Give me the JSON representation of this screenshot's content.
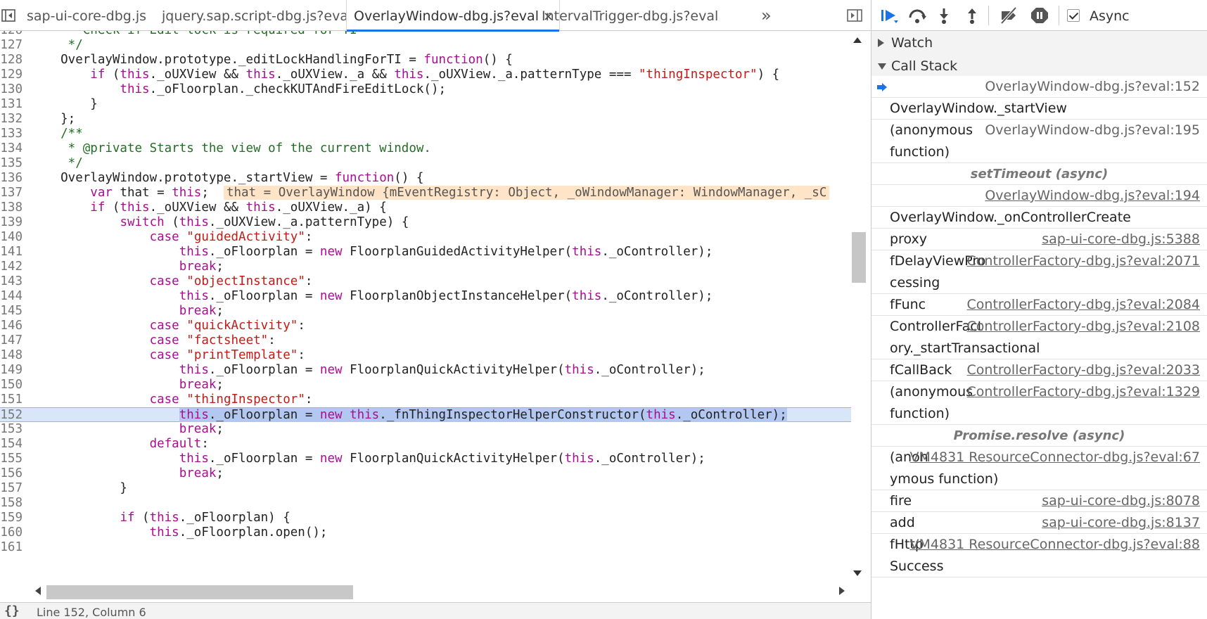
{
  "tabs": [
    {
      "label": "sap-ui-core-dbg.js",
      "active": false
    },
    {
      "label": "jquery.sap.script-dbg.js?eval",
      "active": false
    },
    {
      "label": "OverlayWindow-dbg.js?eval",
      "active": true,
      "close": "×"
    },
    {
      "label": "IntervalTrigger-dbg.js?eval",
      "active": false
    }
  ],
  "overflow_label": "»",
  "code": {
    "lines": [
      {
        "no": "126",
        "parts": [
          {
            "t": "     * Check if Edit lock is required for TI",
            "c": "c"
          }
        ]
      },
      {
        "no": "127",
        "parts": [
          {
            "t": "     */",
            "c": "c"
          }
        ]
      },
      {
        "no": "128",
        "parts": [
          {
            "t": "    OverlayWindow.prototype._editLockHandlingForTI = ",
            "c": "p"
          },
          {
            "t": "function",
            "c": "k"
          },
          {
            "t": "() {",
            "c": "p"
          }
        ]
      },
      {
        "no": "129",
        "parts": [
          {
            "t": "        ",
            "c": "p"
          },
          {
            "t": "if",
            "c": "k"
          },
          {
            "t": " (",
            "c": "p"
          },
          {
            "t": "this",
            "c": "k"
          },
          {
            "t": "._oUXView && ",
            "c": "p"
          },
          {
            "t": "this",
            "c": "k"
          },
          {
            "t": "._oUXView._a && ",
            "c": "p"
          },
          {
            "t": "this",
            "c": "k"
          },
          {
            "t": "._oUXView._a.patternType === ",
            "c": "p"
          },
          {
            "t": "\"thingInspector\"",
            "c": "s"
          },
          {
            "t": ") {",
            "c": "p"
          }
        ]
      },
      {
        "no": "130",
        "parts": [
          {
            "t": "            ",
            "c": "p"
          },
          {
            "t": "this",
            "c": "k"
          },
          {
            "t": "._oFloorplan._checkKUTAndFireEditLock();",
            "c": "p"
          }
        ]
      },
      {
        "no": "131",
        "parts": [
          {
            "t": "        }",
            "c": "p"
          }
        ]
      },
      {
        "no": "132",
        "parts": [
          {
            "t": "    };",
            "c": "p"
          }
        ]
      },
      {
        "no": "133",
        "parts": [
          {
            "t": "    /**",
            "c": "c"
          }
        ]
      },
      {
        "no": "134",
        "parts": [
          {
            "t": "     * @private Starts the view of the current window.",
            "c": "c"
          }
        ]
      },
      {
        "no": "135",
        "parts": [
          {
            "t": "     */",
            "c": "c"
          }
        ]
      },
      {
        "no": "136",
        "parts": [
          {
            "t": "    OverlayWindow.prototype._startView = ",
            "c": "p"
          },
          {
            "t": "function",
            "c": "k"
          },
          {
            "t": "() {",
            "c": "p"
          }
        ]
      },
      {
        "no": "137",
        "parts": [
          {
            "t": "        ",
            "c": "p"
          },
          {
            "t": "var",
            "c": "k"
          },
          {
            "t": " that = ",
            "c": "p"
          },
          {
            "t": "this",
            "c": "k"
          },
          {
            "t": ";  ",
            "c": "p"
          },
          {
            "t": "that = OverlayWindow {mEventRegistry: Object, _oWindowManager: WindowManager, _sC",
            "c": "inline"
          }
        ]
      },
      {
        "no": "138",
        "parts": [
          {
            "t": "        ",
            "c": "p"
          },
          {
            "t": "if",
            "c": "k"
          },
          {
            "t": " (",
            "c": "p"
          },
          {
            "t": "this",
            "c": "k"
          },
          {
            "t": "._oUXView && ",
            "c": "p"
          },
          {
            "t": "this",
            "c": "k"
          },
          {
            "t": "._oUXView._a) {",
            "c": "p"
          }
        ]
      },
      {
        "no": "139",
        "parts": [
          {
            "t": "            ",
            "c": "p"
          },
          {
            "t": "switch",
            "c": "k"
          },
          {
            "t": " (",
            "c": "p"
          },
          {
            "t": "this",
            "c": "k"
          },
          {
            "t": "._oUXView._a.patternType) {",
            "c": "p"
          }
        ]
      },
      {
        "no": "140",
        "parts": [
          {
            "t": "                ",
            "c": "p"
          },
          {
            "t": "case",
            "c": "k"
          },
          {
            "t": " ",
            "c": "p"
          },
          {
            "t": "\"guidedActivity\"",
            "c": "s"
          },
          {
            "t": ":",
            "c": "p"
          }
        ]
      },
      {
        "no": "141",
        "parts": [
          {
            "t": "                    ",
            "c": "p"
          },
          {
            "t": "this",
            "c": "k"
          },
          {
            "t": "._oFloorplan = ",
            "c": "p"
          },
          {
            "t": "new",
            "c": "k"
          },
          {
            "t": " FloorplanGuidedActivityHelper(",
            "c": "p"
          },
          {
            "t": "this",
            "c": "k"
          },
          {
            "t": "._oController);",
            "c": "p"
          }
        ]
      },
      {
        "no": "142",
        "parts": [
          {
            "t": "                    ",
            "c": "p"
          },
          {
            "t": "break",
            "c": "k"
          },
          {
            "t": ";",
            "c": "p"
          }
        ]
      },
      {
        "no": "143",
        "parts": [
          {
            "t": "                ",
            "c": "p"
          },
          {
            "t": "case",
            "c": "k"
          },
          {
            "t": " ",
            "c": "p"
          },
          {
            "t": "\"objectInstance\"",
            "c": "s"
          },
          {
            "t": ":",
            "c": "p"
          }
        ]
      },
      {
        "no": "144",
        "parts": [
          {
            "t": "                    ",
            "c": "p"
          },
          {
            "t": "this",
            "c": "k"
          },
          {
            "t": "._oFloorplan = ",
            "c": "p"
          },
          {
            "t": "new",
            "c": "k"
          },
          {
            "t": " FloorplanObjectInstanceHelper(",
            "c": "p"
          },
          {
            "t": "this",
            "c": "k"
          },
          {
            "t": "._oController);",
            "c": "p"
          }
        ]
      },
      {
        "no": "145",
        "parts": [
          {
            "t": "                    ",
            "c": "p"
          },
          {
            "t": "break",
            "c": "k"
          },
          {
            "t": ";",
            "c": "p"
          }
        ]
      },
      {
        "no": "146",
        "parts": [
          {
            "t": "                ",
            "c": "p"
          },
          {
            "t": "case",
            "c": "k"
          },
          {
            "t": " ",
            "c": "p"
          },
          {
            "t": "\"quickActivity\"",
            "c": "s"
          },
          {
            "t": ":",
            "c": "p"
          }
        ]
      },
      {
        "no": "147",
        "parts": [
          {
            "t": "                ",
            "c": "p"
          },
          {
            "t": "case",
            "c": "k"
          },
          {
            "t": " ",
            "c": "p"
          },
          {
            "t": "\"factsheet\"",
            "c": "s"
          },
          {
            "t": ":",
            "c": "p"
          }
        ]
      },
      {
        "no": "148",
        "parts": [
          {
            "t": "                ",
            "c": "p"
          },
          {
            "t": "case",
            "c": "k"
          },
          {
            "t": " ",
            "c": "p"
          },
          {
            "t": "\"printTemplate\"",
            "c": "s"
          },
          {
            "t": ":",
            "c": "p"
          }
        ]
      },
      {
        "no": "149",
        "parts": [
          {
            "t": "                    ",
            "c": "p"
          },
          {
            "t": "this",
            "c": "k"
          },
          {
            "t": "._oFloorplan = ",
            "c": "p"
          },
          {
            "t": "new",
            "c": "k"
          },
          {
            "t": " FloorplanQuickActivityHelper(",
            "c": "p"
          },
          {
            "t": "this",
            "c": "k"
          },
          {
            "t": "._oController);",
            "c": "p"
          }
        ]
      },
      {
        "no": "150",
        "parts": [
          {
            "t": "                    ",
            "c": "p"
          },
          {
            "t": "break",
            "c": "k"
          },
          {
            "t": ";",
            "c": "p"
          }
        ]
      },
      {
        "no": "151",
        "parts": [
          {
            "t": "                ",
            "c": "p"
          },
          {
            "t": "case",
            "c": "k"
          },
          {
            "t": " ",
            "c": "p"
          },
          {
            "t": "\"thingInspector\"",
            "c": "s"
          },
          {
            "t": ":",
            "c": "p"
          }
        ]
      },
      {
        "no": "152",
        "current": true,
        "parts": [
          {
            "t": "                    ",
            "c": "p"
          },
          {
            "t": "this",
            "c": "k sel"
          },
          {
            "t": "._oFloorplan = ",
            "c": "p sel"
          },
          {
            "t": "new",
            "c": "k sel"
          },
          {
            "t": " ",
            "c": "p sel"
          },
          {
            "t": "this",
            "c": "k sel"
          },
          {
            "t": "._fnThingInspectorHelperConstructor(",
            "c": "p sel"
          },
          {
            "t": "this",
            "c": "k sel"
          },
          {
            "t": "._oController);",
            "c": "p sel"
          }
        ]
      },
      {
        "no": "153",
        "parts": [
          {
            "t": "                    ",
            "c": "p"
          },
          {
            "t": "break",
            "c": "k"
          },
          {
            "t": ";",
            "c": "p"
          }
        ]
      },
      {
        "no": "154",
        "parts": [
          {
            "t": "                ",
            "c": "p"
          },
          {
            "t": "default",
            "c": "k"
          },
          {
            "t": ":",
            "c": "p"
          }
        ]
      },
      {
        "no": "155",
        "parts": [
          {
            "t": "                    ",
            "c": "p"
          },
          {
            "t": "this",
            "c": "k"
          },
          {
            "t": "._oFloorplan = ",
            "c": "p"
          },
          {
            "t": "new",
            "c": "k"
          },
          {
            "t": " FloorplanQuickActivityHelper(",
            "c": "p"
          },
          {
            "t": "this",
            "c": "k"
          },
          {
            "t": "._oController);",
            "c": "p"
          }
        ]
      },
      {
        "no": "156",
        "parts": [
          {
            "t": "                    ",
            "c": "p"
          },
          {
            "t": "break",
            "c": "k"
          },
          {
            "t": ";",
            "c": "p"
          }
        ]
      },
      {
        "no": "157",
        "parts": [
          {
            "t": "            }",
            "c": "p"
          }
        ]
      },
      {
        "no": "158",
        "parts": [
          {
            "t": "",
            "c": "p"
          }
        ]
      },
      {
        "no": "159",
        "parts": [
          {
            "t": "            ",
            "c": "p"
          },
          {
            "t": "if",
            "c": "k"
          },
          {
            "t": " (",
            "c": "p"
          },
          {
            "t": "this",
            "c": "k"
          },
          {
            "t": "._oFloorplan) {",
            "c": "p"
          }
        ]
      },
      {
        "no": "160",
        "parts": [
          {
            "t": "                ",
            "c": "p"
          },
          {
            "t": "this",
            "c": "k"
          },
          {
            "t": "._oFloorplan.open();",
            "c": "p"
          }
        ]
      },
      {
        "no": "161",
        "parts": [
          {
            "t": "",
            "c": "p"
          }
        ]
      }
    ]
  },
  "status_bar": {
    "pretty_print": "{}",
    "cursor_position": "Line 152, Column 6"
  },
  "debugger": {
    "async_label": "Async",
    "async_checked": true,
    "watch_label": "Watch",
    "call_stack_label": "Call Stack",
    "frames": [
      {
        "type": "frame",
        "name": "",
        "location": "OverlayWindow-dbg.js?eval:152",
        "selected": true,
        "underline": false,
        "rows": 1
      },
      {
        "type": "frame",
        "name": "OverlayWindow._startView",
        "location": "",
        "rows": 1
      },
      {
        "type": "frame",
        "name": "(anonymous",
        "name2": "function)",
        "location": "OverlayWindow-dbg.js?eval:195",
        "underline": false,
        "rows": 2
      },
      {
        "type": "async",
        "label": "setTimeout (async)"
      },
      {
        "type": "frame",
        "name": "",
        "location": "OverlayWindow-dbg.js?eval:194",
        "underline": true,
        "rows": 1
      },
      {
        "type": "frame",
        "name": "OverlayWindow._onControllerCreate",
        "location": "",
        "rows": 1
      },
      {
        "type": "frame",
        "name": "proxy",
        "location": "sap-ui-core-dbg.js:5388",
        "underline": true,
        "rows": 1
      },
      {
        "type": "frame",
        "name": "fDelayViewPro",
        "name2": "cessing",
        "location": "ControllerFactory-dbg.js?eval:2071",
        "underline": true,
        "rows": 2
      },
      {
        "type": "frame",
        "name": "fFunc",
        "location": "ControllerFactory-dbg.js?eval:2084",
        "underline": true,
        "rows": 1
      },
      {
        "type": "frame",
        "name": "ControllerFact",
        "name2": "ory._startTransactional",
        "location": "ControllerFactory-dbg.js?eval:2108",
        "underline": true,
        "rows": 2
      },
      {
        "type": "frame",
        "name": "fCallBack",
        "location": "ControllerFactory-dbg.js?eval:2033",
        "underline": true,
        "rows": 1
      },
      {
        "type": "frame",
        "name": "(anonymous",
        "name2": "function)",
        "location": "ControllerFactory-dbg.js?eval:1329",
        "underline": true,
        "rows": 2
      },
      {
        "type": "async",
        "label": "Promise.resolve (async)"
      },
      {
        "type": "frame",
        "name": "(anon",
        "name2": "ymous function)",
        "location": "VM4831 ResourceConnector-dbg.js?eval:67",
        "underline": true,
        "rows": 2
      },
      {
        "type": "frame",
        "name": "fire",
        "location": "sap-ui-core-dbg.js:8078",
        "underline": true,
        "rows": 1
      },
      {
        "type": "frame",
        "name": "add",
        "location": "sap-ui-core-dbg.js:8137",
        "underline": true,
        "rows": 1
      },
      {
        "type": "frame",
        "name": "fHttp",
        "name2": "Success",
        "location": "VM4831 ResourceConnector-dbg.js?eval:88",
        "underline": true,
        "rows": 2
      }
    ]
  },
  "colors": {
    "accent": "#1a73e8",
    "keyword": "#a90d91",
    "string": "#c41a16",
    "comment": "#236e25",
    "current_line": "#d9e6fa"
  }
}
